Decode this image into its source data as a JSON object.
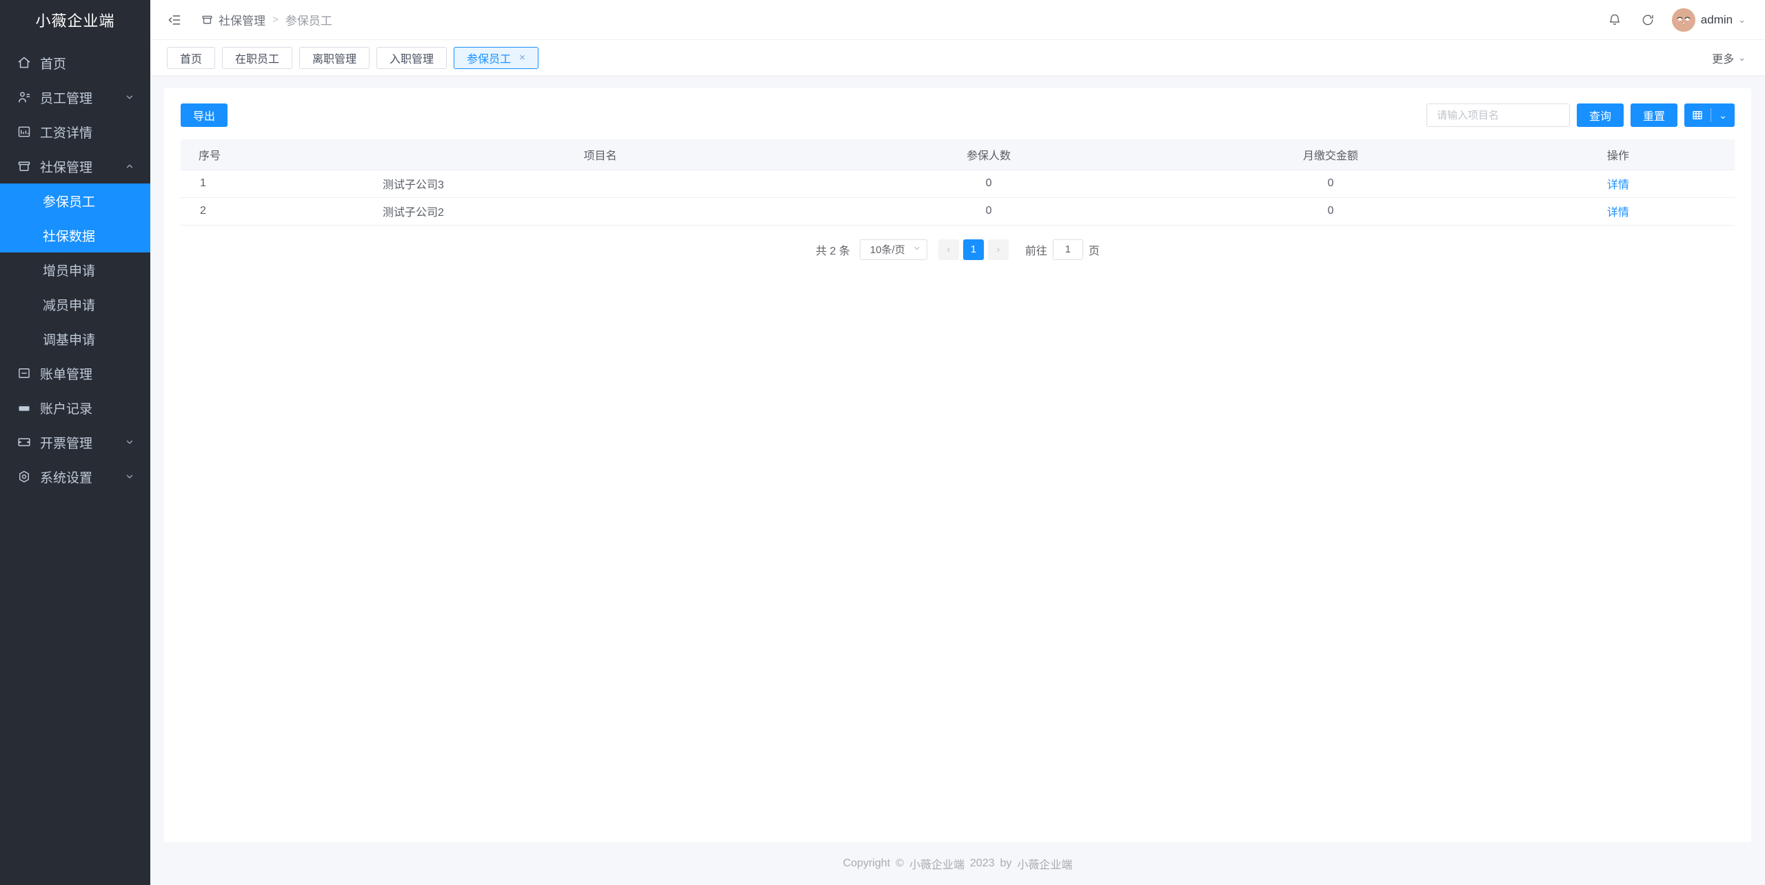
{
  "app": {
    "brand": "小薇企业端"
  },
  "sidebar": {
    "items": [
      {
        "label": "首页",
        "icon": "home-icon",
        "expandable": false
      },
      {
        "label": "员工管理",
        "icon": "users-icon",
        "expandable": true,
        "expanded": false
      },
      {
        "label": "工资详情",
        "icon": "salary-chart-icon",
        "expandable": false
      },
      {
        "label": "社保管理",
        "icon": "folder-icon",
        "expandable": true,
        "expanded": true,
        "children": [
          {
            "label": "参保员工",
            "active": true
          },
          {
            "label": "社保数据",
            "active": true
          },
          {
            "label": "增员申请",
            "active": false
          },
          {
            "label": "减员申请",
            "active": false
          },
          {
            "label": "调基申请",
            "active": false
          }
        ]
      },
      {
        "label": "账单管理",
        "icon": "bill-icon",
        "expandable": false
      },
      {
        "label": "账户记录",
        "icon": "wallet-icon",
        "expandable": false
      },
      {
        "label": "开票管理",
        "icon": "ticket-icon",
        "expandable": true,
        "expanded": false
      },
      {
        "label": "系统设置",
        "icon": "settings-icon",
        "expandable": true,
        "expanded": false
      }
    ]
  },
  "navbar": {
    "collapse_icon": "collapse-menu-icon",
    "breadcrumb": {
      "folder_icon": "folder-icon",
      "parent": "社保管理",
      "separator": ">",
      "current": "参保员工"
    },
    "bell_icon": "bell-icon",
    "refresh_icon": "refresh-icon",
    "avatar_icon": "user-avatar",
    "user_name": "admin",
    "user_caret": "⌄"
  },
  "tabsbar": {
    "tabs": [
      {
        "label": "首页",
        "active": false,
        "closable": false
      },
      {
        "label": "在职员工",
        "active": false,
        "closable": false
      },
      {
        "label": "离职管理",
        "active": false,
        "closable": false
      },
      {
        "label": "入职管理",
        "active": false,
        "closable": false
      },
      {
        "label": "参保员工",
        "active": true,
        "closable": true,
        "close_glyph": "×"
      }
    ],
    "more_label": "更多",
    "more_caret": "⌄"
  },
  "toolbar": {
    "export_label": "导出",
    "search_placeholder": "请输入项目名",
    "search_value": "",
    "query_label": "查询",
    "reset_label": "重置",
    "columns_icon": "grid-columns-icon",
    "columns_caret": "⌄"
  },
  "table": {
    "columns": [
      "序号",
      "项目名",
      "参保人数",
      "月缴交金额",
      "操作"
    ],
    "rows": [
      {
        "index": "1",
        "name": "测试子公司3",
        "insured_count": "0",
        "monthly_amount": "0",
        "action": "详情"
      },
      {
        "index": "2",
        "name": "测试子公司2",
        "insured_count": "0",
        "monthly_amount": "0",
        "action": "详情"
      }
    ]
  },
  "pagination": {
    "total_text": "共 2 条",
    "page_size": "10条/页",
    "prev_glyph": "‹",
    "next_glyph": "›",
    "current_page": "1",
    "jump_prefix": "前往",
    "jump_value": "1",
    "jump_suffix": "页"
  },
  "footer": {
    "copyright_prefix": "Copyright",
    "copyright_symbol": "©",
    "company": "小薇企业端",
    "year": "2023",
    "by": "by",
    "owner": "小薇企业端"
  },
  "colors": {
    "accent": "#1890ff",
    "sidebar_bg": "#282c34",
    "page_bg": "#f5f7fa",
    "header_row_bg": "#f5f7fa"
  }
}
